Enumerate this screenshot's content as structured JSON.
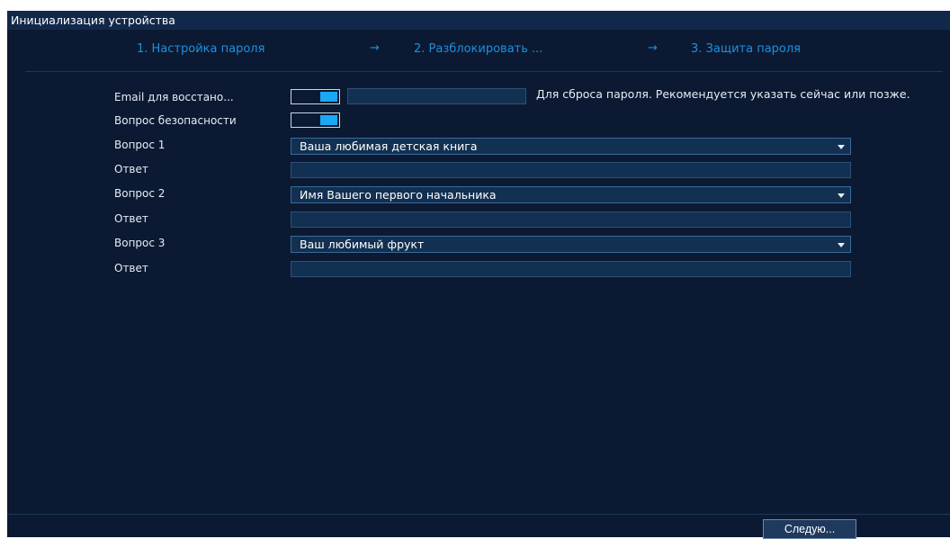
{
  "window": {
    "title": "Инициализация устройства"
  },
  "steps": [
    {
      "label": "1.  Настройка пароля"
    },
    {
      "label": "2.  Разблокировать ..."
    },
    {
      "label": "3.  Защита пароля"
    }
  ],
  "arrow_glyph": "→",
  "form": {
    "email_label": "Email для восстано...",
    "email_value": "",
    "email_hint": "Для сброса пароля. Рекомендуется указать сейчас или позже.",
    "security_label": "Вопрос безопасности",
    "questions": [
      {
        "label": "Вопрос 1",
        "selected": "Ваша любимая детская книга",
        "answer_label": "Ответ",
        "answer_value": ""
      },
      {
        "label": "Вопрос 2",
        "selected": "Имя Вашего первого начальника",
        "answer_label": "Ответ",
        "answer_value": ""
      },
      {
        "label": "Вопрос 3",
        "selected": "Ваш любимый фрукт",
        "answer_label": "Ответ",
        "answer_value": ""
      }
    ]
  },
  "footer": {
    "next_label": "Следую..."
  },
  "colors": {
    "background": "#0b1a32",
    "accent": "#1f8fe0",
    "toggle_on": "#19a8f5"
  }
}
